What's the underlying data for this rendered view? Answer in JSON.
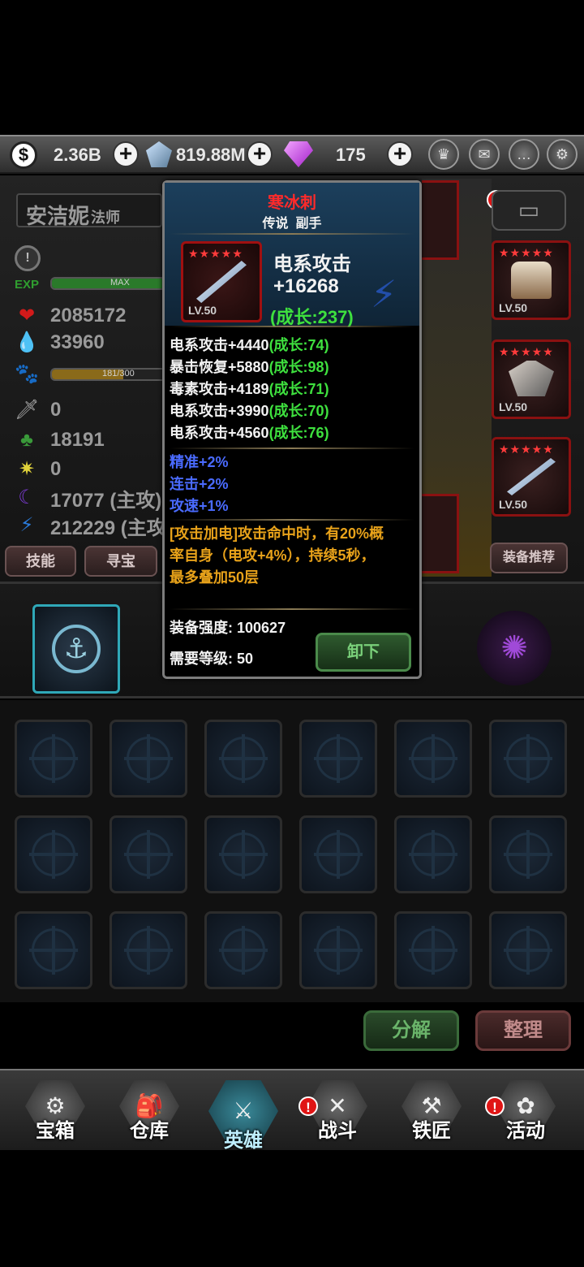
{
  "currency": {
    "gold": "2.36B",
    "crystal": "819.88M",
    "gem": "175"
  },
  "hero": {
    "name": "安洁妮",
    "class": "法师",
    "exp_label": "EXP",
    "exp_max": "MAX",
    "exp_fraction": 1.0,
    "hp": "2085172",
    "mp": "33960",
    "pet_progress": "181/300",
    "pet_fraction": 0.603,
    "stat_sword": "0",
    "stat_clover": "18191",
    "stat_sun": "0",
    "stat_moon": "17077 (主攻)",
    "stat_lightning": "212229 (主攻"
  },
  "buttons": {
    "skills": "技能",
    "treasure": "寻宝",
    "equip_recommend": "装备推荐",
    "decompose": "分解",
    "organize": "整理"
  },
  "equipment": {
    "right_slots": [
      {
        "level": "LV.50",
        "stars": "★★★★★",
        "icon": "armor-icon"
      },
      {
        "level": "LV.50",
        "stars": "★★★★★",
        "icon": "gauntlet-icon"
      },
      {
        "level": "LV.50",
        "stars": "★★★★★",
        "icon": "dagger-icon"
      }
    ]
  },
  "tooltip": {
    "name": "寒冰刺",
    "subtitle": "传说  副手",
    "item_level": "LV.50",
    "item_stars": "★★★★★",
    "main_stat": "电系攻击",
    "main_value": "+16268",
    "main_growth": "(成长:237)",
    "sub_stats": [
      {
        "text": "电系攻击+4440",
        "growth": "(成长:74)"
      },
      {
        "text": "暴击恢复+5880",
        "growth": "(成长:98)"
      },
      {
        "text": "毒素攻击+4189",
        "growth": "(成长:71)"
      },
      {
        "text": "电系攻击+3990",
        "growth": "(成长:70)"
      },
      {
        "text": "电系攻击+4560",
        "growth": "(成长:76)"
      }
    ],
    "bonus_stats": [
      "精准+2%",
      "连击+2%",
      "攻速+1%"
    ],
    "skill_lines": [
      "[攻击加电]攻击命中时，有20%概",
      "率自身（电攻+4%），持续5秒，",
      "最多叠加50层"
    ],
    "strength_label": "装备强度:",
    "strength_value": "100627",
    "req_level_label": "需要等级:",
    "req_level_value": "50",
    "unequip_label": "卸下"
  },
  "nav": [
    {
      "label": "宝箱",
      "icon": "chest-icon",
      "badge": false
    },
    {
      "label": "仓库",
      "icon": "backpack-icon",
      "badge": false
    },
    {
      "label": "英雄",
      "icon": "hero-icon",
      "badge": false
    },
    {
      "label": "战斗",
      "icon": "battle-icon",
      "badge": true
    },
    {
      "label": "铁匠",
      "icon": "smith-icon",
      "badge": false
    },
    {
      "label": "活动",
      "icon": "event-icon",
      "badge": true
    }
  ],
  "colors": {
    "accent_red": "#e01515",
    "growth_green": "#3ee03e",
    "bonus_blue": "#4a6bff",
    "skill_orange": "#e8a21a"
  }
}
